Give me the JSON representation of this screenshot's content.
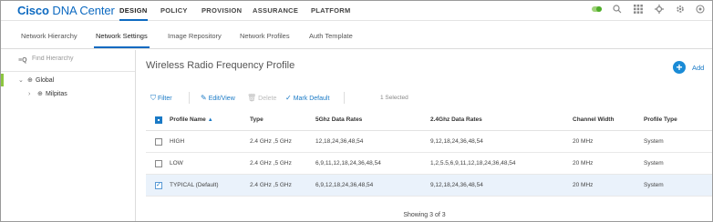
{
  "brand": {
    "name_bold": "Cisco",
    "name_rest": " DNA Center"
  },
  "topnav": {
    "items": [
      "DESIGN",
      "POLICY",
      "PROVISION",
      "ASSURANCE",
      "PLATFORM"
    ],
    "active": "DESIGN"
  },
  "topicons": [
    "status-toggle-icon",
    "search-icon",
    "apps-grid-icon",
    "tools-icon",
    "settings-gear-icon",
    "help-icon"
  ],
  "subnav": {
    "items": [
      "Network Hierarchy",
      "Network Settings",
      "Image Repository",
      "Network Profiles",
      "Auth Template"
    ],
    "active": "Network Settings"
  },
  "sidebar": {
    "find_placeholder": "Find Hierarchy",
    "tree": [
      {
        "label": "Global",
        "level": 0,
        "expanded": true
      },
      {
        "label": "Milpitas",
        "level": 1,
        "expanded": false
      }
    ]
  },
  "main": {
    "title": "Wireless Radio Frequency Profile",
    "add_label": "Add",
    "toolbar": {
      "filter": "Filter",
      "edit_view": "Edit/View",
      "delete": "Delete",
      "mark_default": "Mark Default",
      "selected_count": "1 Selected"
    },
    "table": {
      "columns": [
        "Profile Name",
        "Type",
        "5Ghz Data Rates",
        "2.4Ghz Data Rates",
        "Channel Width",
        "Profile Type"
      ],
      "rows": [
        {
          "checked": false,
          "cells": [
            "HIGH",
            "2.4 GHz ,5 GHz",
            "12,18,24,36,48,54",
            "9,12,18,24,36,48,54",
            "20 MHz",
            "System"
          ]
        },
        {
          "checked": false,
          "cells": [
            "LOW",
            "2.4 GHz ,5 GHz",
            "6,9,11,12,18,24,36,48,54",
            "1,2,5.5,6,9,11,12,18,24,36,48,54",
            "20 MHz",
            "System"
          ]
        },
        {
          "checked": true,
          "cells": [
            "TYPICAL (Default)",
            "2.4 GHz ,5 GHz",
            "6,9,12,18,24,36,48,54",
            "9,12,18,24,36,48,54",
            "20 MHz",
            "System"
          ]
        }
      ]
    },
    "footer": "Showing 3 of 3"
  },
  "colors": {
    "accent": "#1a7ac6",
    "brand": "#0d6ac1",
    "tree_marker": "#8cc63f",
    "selected_row": "#eaf2fb"
  }
}
